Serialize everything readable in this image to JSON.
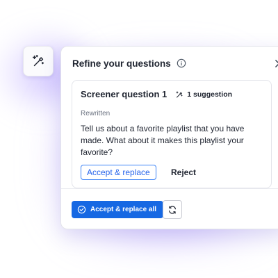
{
  "panel": {
    "title": "Refine your questions"
  },
  "card": {
    "title": "Screener question 1",
    "suggestion_count": "1 suggestion",
    "label": "Rewritten",
    "text": "Tell us about a favorite playlist that you have made. What about it makes this playlist your favorite?",
    "accept_label": "Accept & replace",
    "reject_label": "Reject"
  },
  "footer": {
    "accept_all_label": "Accept & replace all"
  },
  "icons": {
    "launcher": "magic-wand-icon",
    "info": "info-icon",
    "close": "close-icon",
    "suggestion": "magic-wand-icon",
    "accept_all": "check-circle-icon",
    "refresh": "refresh-icon"
  },
  "colors": {
    "primary": "#1668e3",
    "accent_outline": "#3b82f6",
    "glow": "#7b5cff"
  }
}
